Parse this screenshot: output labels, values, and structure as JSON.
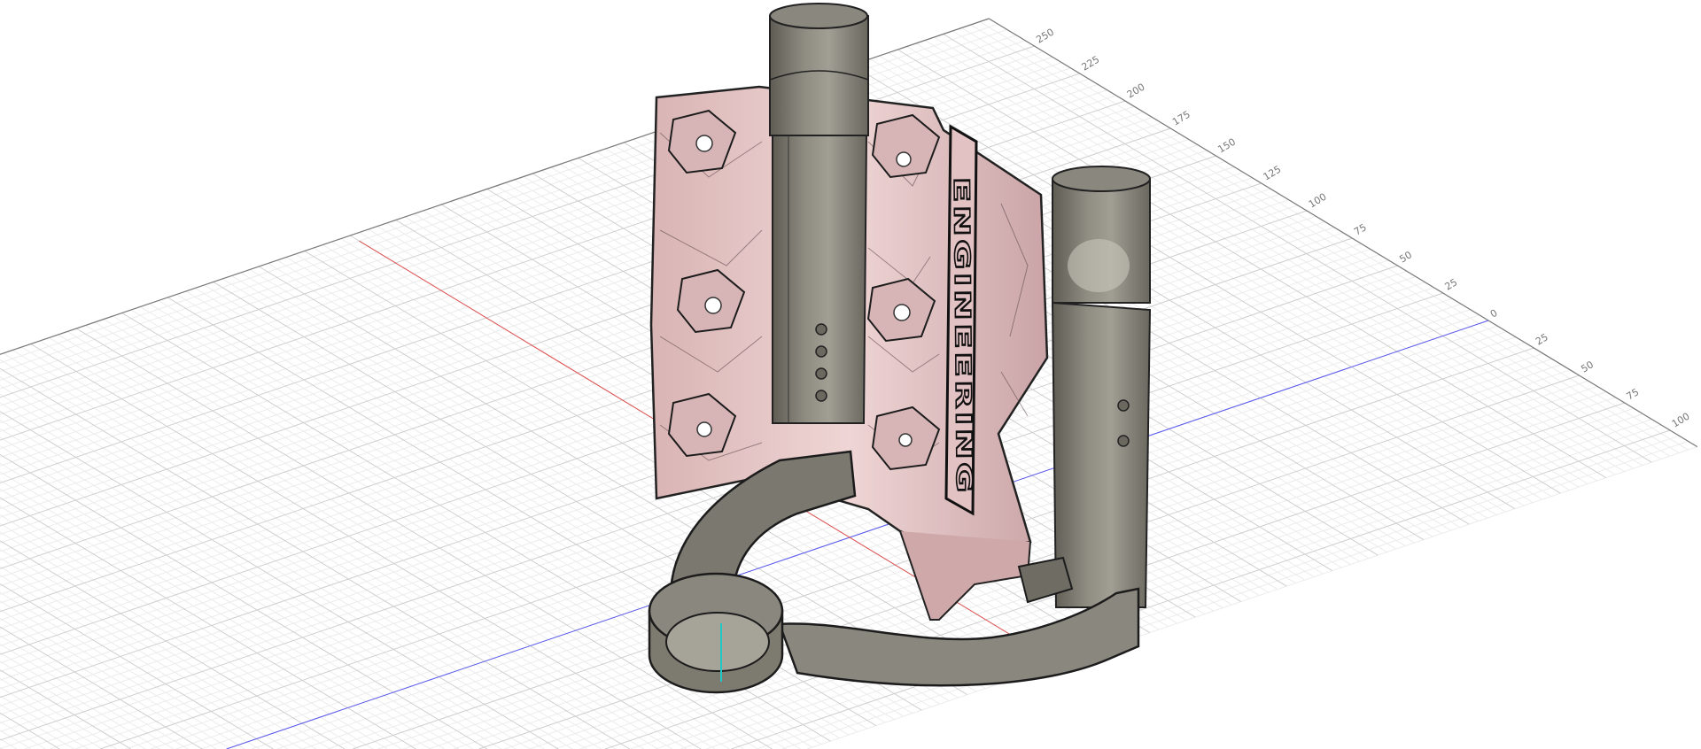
{
  "viewport": {
    "background": "#ffffff",
    "grid": {
      "minor_step": 5,
      "major_step": 25,
      "edge_labels_positive": [
        "25",
        "50",
        "75",
        "100",
        "125",
        "150",
        "175",
        "200",
        "225",
        "250"
      ],
      "edge_labels_negative": [
        "25",
        "50",
        "75",
        "100"
      ],
      "origin_label": "0",
      "minor_color": "#ececec",
      "major_color": "#cfcfcf",
      "edge_color": "#7a7a7a"
    },
    "axes": {
      "x_axis_color": "#e05050",
      "y_axis_color": "#5a5af0",
      "z_axis_color": "#20c8c8"
    },
    "model": {
      "body_color": "#e9c9c9",
      "tube_color": "#7d7a70",
      "engraving_text": "ENGINEERING"
    }
  }
}
